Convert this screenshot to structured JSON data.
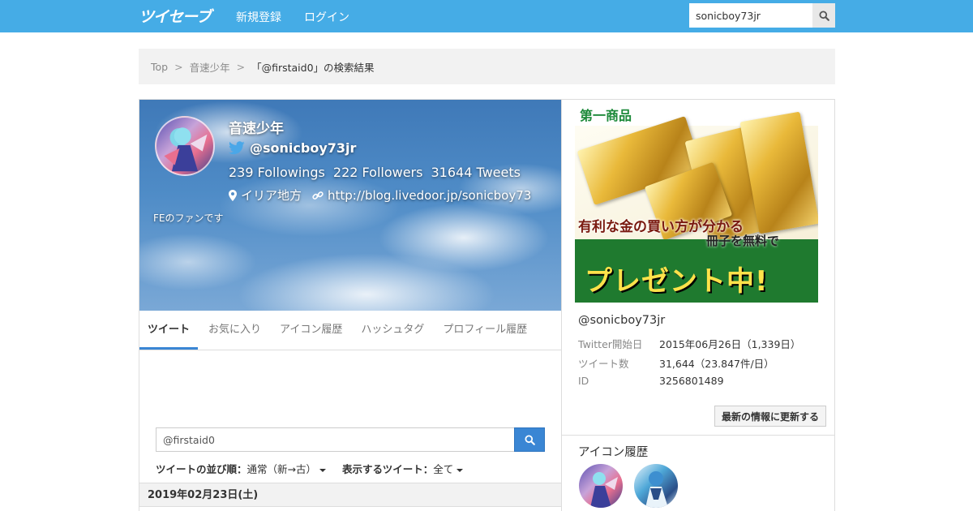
{
  "header": {
    "logo": "ツイセーブ",
    "nav": {
      "register": "新規登録",
      "login": "ログイン"
    },
    "search": {
      "value": "sonicboy73jr",
      "icon": "search-icon"
    },
    "bg_color": "#45ace6"
  },
  "breadcrumb": {
    "items": [
      "Top",
      "音速少年"
    ],
    "separator": ">",
    "current": "「@firstaid0」の検索結果"
  },
  "profile": {
    "name": "音速少年",
    "handle": "@sonicboy73jr",
    "followings": "239 Followings",
    "followers": "222 Followers",
    "tweets": "31644 Tweets",
    "location": "イリア地方",
    "url": "http://blog.livedoor.jp/sonicboy73",
    "bio": "FEのファンです"
  },
  "tabs": [
    {
      "label": "ツイート",
      "active": true
    },
    {
      "label": "お気に入り",
      "active": false
    },
    {
      "label": "アイコン履歴",
      "active": false
    },
    {
      "label": "ハッシュタグ",
      "active": false
    },
    {
      "label": "プロフィール履歴",
      "active": false
    }
  ],
  "tweet_search": {
    "value": "@firstaid0",
    "sort_label": "ツイートの並び順：",
    "sort_value": "通常（新→古）",
    "filter_label": "表示するツイート：",
    "filter_value": "全て"
  },
  "date_header": "2019年02月23日(土)",
  "ad": {
    "brand": "第一商品",
    "line1": "有利な金の買い方が分かる",
    "line2": "冊子を無料で",
    "line3": "プレゼント中!"
  },
  "account": {
    "handle": "@sonicboy73jr",
    "stats": [
      {
        "label": "Twitter開始日",
        "value": "2015年06月26日（1,339日）"
      },
      {
        "label": "ツイート数",
        "value": "31,644（23.847件/日）"
      },
      {
        "label": "ID",
        "value": "3256801489"
      }
    ],
    "update_button": "最新の情報に更新する"
  },
  "icon_history": {
    "title": "アイコン履歴"
  }
}
